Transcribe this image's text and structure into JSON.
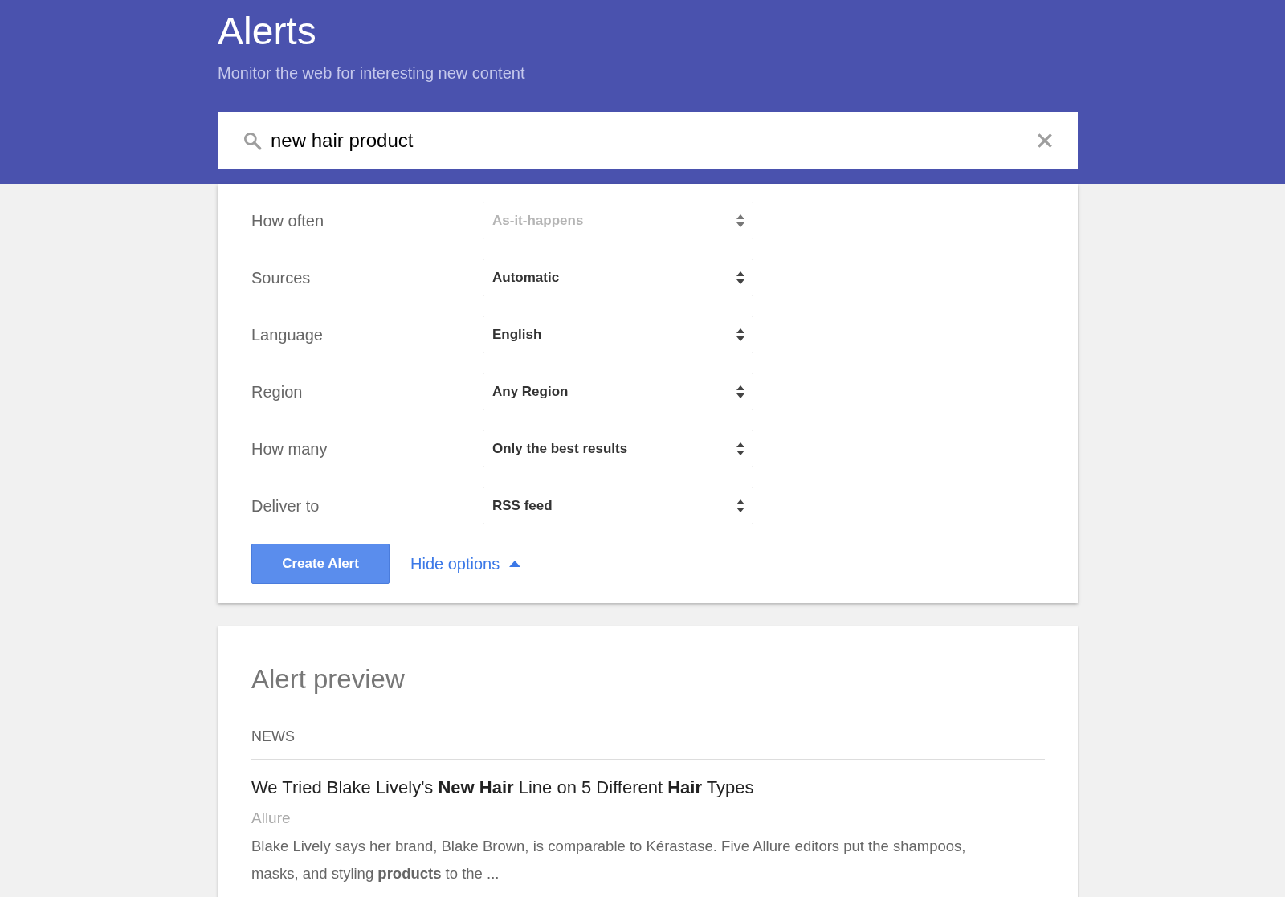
{
  "header": {
    "title": "Alerts",
    "subtitle": "Monitor the web for interesting new content"
  },
  "search": {
    "value": "new hair product"
  },
  "options": [
    {
      "label": "How often",
      "value": "As-it-happens",
      "disabled": true
    },
    {
      "label": "Sources",
      "value": "Automatic",
      "disabled": false
    },
    {
      "label": "Language",
      "value": "English",
      "disabled": false
    },
    {
      "label": "Region",
      "value": "Any Region",
      "disabled": false
    },
    {
      "label": "How many",
      "value": "Only the best results",
      "disabled": false
    },
    {
      "label": "Deliver to",
      "value": "RSS feed",
      "disabled": false
    }
  ],
  "create_button": "Create Alert",
  "hide_options_link": "Hide options",
  "preview": {
    "title": "Alert preview",
    "section": "NEWS",
    "results": [
      {
        "headline": "We Tried Blake Lively's **New Hair** Line on 5 Different **Hair** Types",
        "source": "Allure",
        "snippet": "Blake Lively says her brand, Blake Brown, is comparable to Kérastase. Five Allure editors put the shampoos, masks, and styling **products** to the ..."
      }
    ]
  }
}
